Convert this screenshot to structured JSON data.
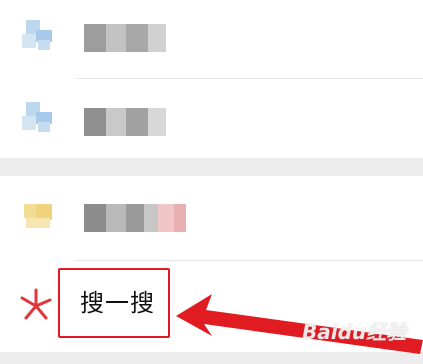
{
  "menu": {
    "items": [
      {
        "label": "",
        "icon": "pixelated-blue-icon"
      },
      {
        "label": "",
        "icon": "pixelated-blue-icon"
      },
      {
        "label": "",
        "icon": "pixelated-yellow-icon"
      },
      {
        "label": "搜一搜",
        "icon": "search-spark-icon"
      }
    ]
  },
  "annotation": {
    "highlight_color": "#e11b22",
    "arrow_color": "#e11b22"
  },
  "watermark": "Baidu经验"
}
